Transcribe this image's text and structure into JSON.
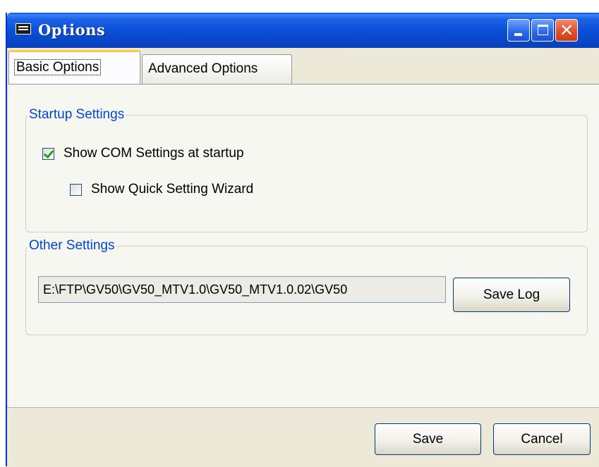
{
  "window": {
    "title": "Options",
    "controls": {
      "minimize": "minimize-icon",
      "maximize": "maximize-icon",
      "close": "close-icon"
    }
  },
  "tabs": [
    {
      "label": "Basic Options",
      "active": true
    },
    {
      "label": "Advanced Options",
      "active": false
    }
  ],
  "startup_settings": {
    "legend": "Startup Settings",
    "show_com_settings": {
      "label": "Show COM Settings at startup",
      "checked": true
    },
    "show_quick_wizard": {
      "label": "Show Quick Setting Wizard",
      "checked": false
    }
  },
  "other_settings": {
    "legend": "Other Settings",
    "log_path": "E:\\FTP\\GV50\\GV50_MTV1.0\\GV50_MTV1.0.02\\GV50",
    "save_log_label": "Save Log"
  },
  "footer": {
    "save_label": "Save",
    "cancel_label": "Cancel"
  },
  "colors": {
    "titlebar": "#0a50d8",
    "group_legend": "#0046d5",
    "active_tab_accent": "#ffc83c",
    "close_button": "#e0502a"
  }
}
